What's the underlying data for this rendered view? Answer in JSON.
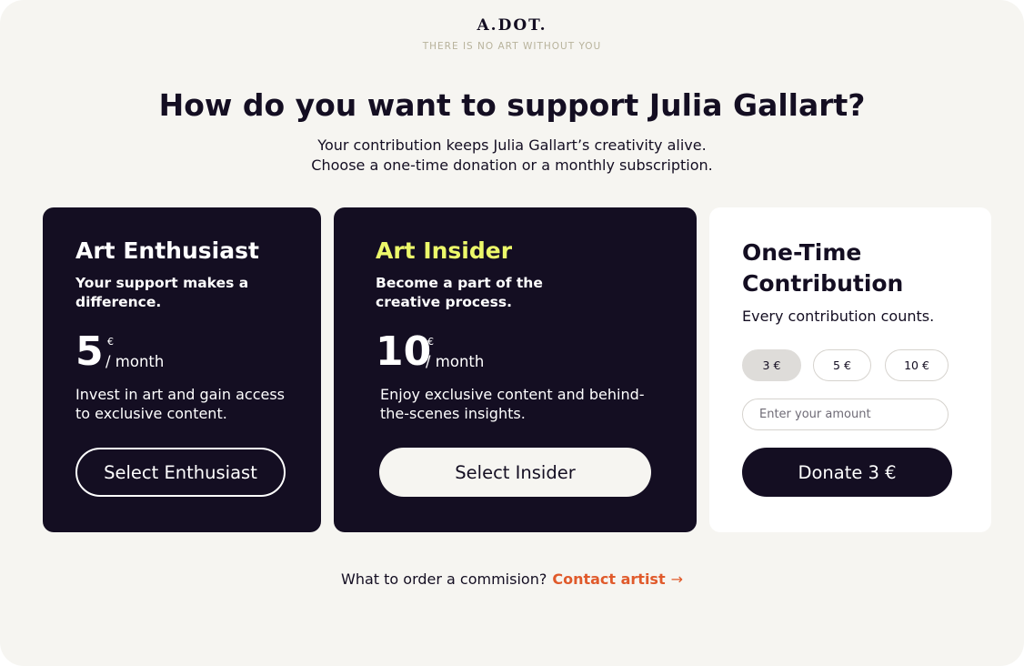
{
  "brand": {
    "logo": "A.DOT.",
    "tagline": "THERE IS NO ART WITHOUT YOU"
  },
  "heading": {
    "title": "How do you want to support Julia Gallart?",
    "subtitle_line1": "Your contribution keeps Julia Gallart’s creativity alive.",
    "subtitle_line2": "Choose a one-time donation or a monthly subscription."
  },
  "plans": [
    {
      "name": "Art Enthusiast",
      "tagline": "Your support makes a difference.",
      "price": "5",
      "currency": "€",
      "period": "/ month",
      "description": "Invest in art and gain access to exclusive content.",
      "button_label": "Select Enthusiast"
    },
    {
      "name": "Art Insider",
      "tagline": "Become a part of the creative process.",
      "price": "10",
      "currency": "€",
      "period": "/ month",
      "description": "Enjoy exclusive content and behind-the-scenes insights.",
      "button_label": "Select Insider"
    }
  ],
  "one_time": {
    "title": "One-Time Contribution",
    "subtitle": "Every contribution counts.",
    "amounts": [
      "3 €",
      "5 €",
      "10 €"
    ],
    "selected_amount": "3 €",
    "amount_placeholder": "Enter your amount",
    "amount_value": "",
    "donate_label": "Donate 3 €"
  },
  "footer": {
    "question": "What to order a commision?",
    "link_label": "Contact artist",
    "link_arrow": "→"
  },
  "colors": {
    "page_background": "#f6f5f1",
    "dark_card": "#140e22",
    "accent_yellow": "#ecf86a",
    "link_orange": "#e05a2b",
    "tagline": "#b8b39c",
    "chip_selected": "#dedcd9"
  }
}
